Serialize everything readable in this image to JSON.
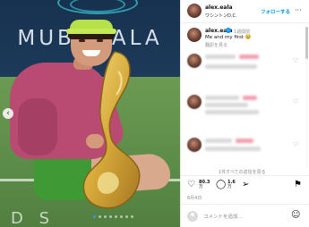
{
  "photo": {
    "banner_text": "MUBADALA",
    "court_text": "D S"
  },
  "post": {
    "username": "alex.eala",
    "location": "ワシントンD.C.",
    "follow_label": "フォローする",
    "more_label": "···",
    "caption": {
      "username": "alex.eala",
      "time": "1週間前",
      "text": "Me and my first 🥹",
      "translate": "翻訳を見る"
    },
    "hidden_comments_link": "1件すべての返信を見る",
    "actions": {
      "likes_value": "80.3",
      "likes_unit": "万",
      "comments_value": "1.6",
      "comments_unit": "万"
    },
    "date": "8月4日",
    "composer_placeholder": "コメントを追加..."
  },
  "icons": {
    "like": "heart-icon",
    "comment": "comment-bubble-icon",
    "share": "paper-plane-icon",
    "save": "bookmark-icon",
    "emoji": "smile-icon",
    "prev": "chevron-left-icon"
  },
  "colors": {
    "accent": "#0095f6",
    "hoodie": "#b94a72",
    "visor": "#b7e14a"
  }
}
